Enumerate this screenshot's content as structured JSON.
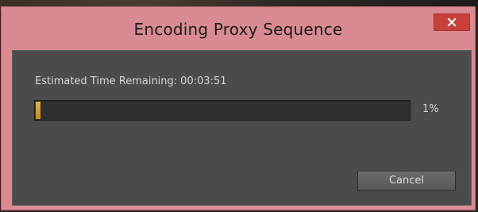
{
  "dialog": {
    "title": "Encoding Proxy Sequence",
    "close_icon": "close-icon",
    "estimate_label": "Estimated Time Remaining:",
    "estimate_value": "00:03:51",
    "progress_percent": 1,
    "progress_label": "1%",
    "cancel_label": "Cancel"
  },
  "colors": {
    "titlebar": "#d98a93",
    "close_button": "#c7413a",
    "panel": "#4b4b4b",
    "progress_fill": "#e0a733"
  }
}
